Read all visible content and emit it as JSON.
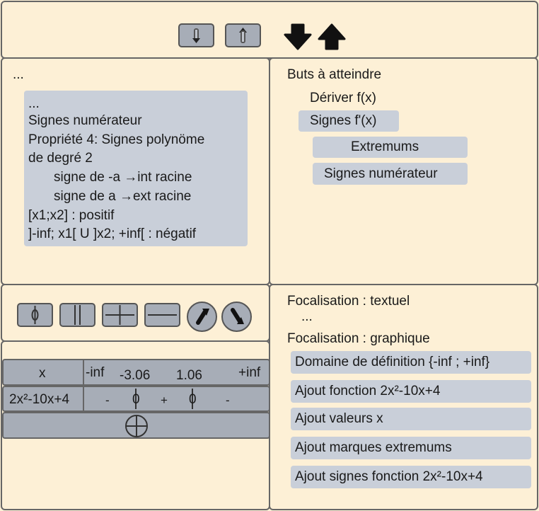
{
  "toolbar": {
    "icons": [
      "arrow-down-icon",
      "arrow-up-icon",
      "bold-arrow-down-icon",
      "bold-arrow-up-icon"
    ]
  },
  "left_panel": {
    "ellipsis": "...",
    "box": {
      "lines": [
        "...",
        "Signes numérateur",
        "Propriété 4: Signes polynöme",
        "de degré 2",
        "signe de -a  →int racine",
        "signe de a   →ext racine",
        "[x1;x2] : positif",
        "]-inf; x1[ U ]x2; +inf[ : négatif"
      ]
    }
  },
  "goals_panel": {
    "title": "Buts à atteindre",
    "items": [
      "Dériver f(x)",
      "Signes f'(x)",
      "Extremums",
      "Signes numérateur"
    ]
  },
  "tools": {
    "icons": [
      "zero-icon",
      "double-bar-icon",
      "plus-icon",
      "minus-icon",
      "arrow-up-right-icon",
      "arrow-down-right-icon"
    ]
  },
  "sign_table": {
    "row1": {
      "label": "x",
      "values": [
        "-inf",
        "-3.06",
        "1.06",
        "+inf"
      ]
    },
    "row2": {
      "label": "2x²-10x+4",
      "signs": [
        "-",
        "0",
        "+",
        "0",
        "-"
      ]
    },
    "add_icon": "add-row-icon"
  },
  "focus_panel": {
    "textual_label": "Focalisation : textuel",
    "ellipsis": "...",
    "graphic_label": "Focalisation : graphique",
    "items": [
      "Domaine de définition {-inf ; +inf}",
      "Ajout fonction 2x²-10x+4",
      "Ajout valeurs x",
      "Ajout marques extremums",
      "Ajout signes fonction 2x²-10x+4"
    ]
  },
  "colors": {
    "background": "#fdf0d6",
    "button": "#a7adb7",
    "highlight": "#c9cfd9",
    "border": "#666666"
  }
}
